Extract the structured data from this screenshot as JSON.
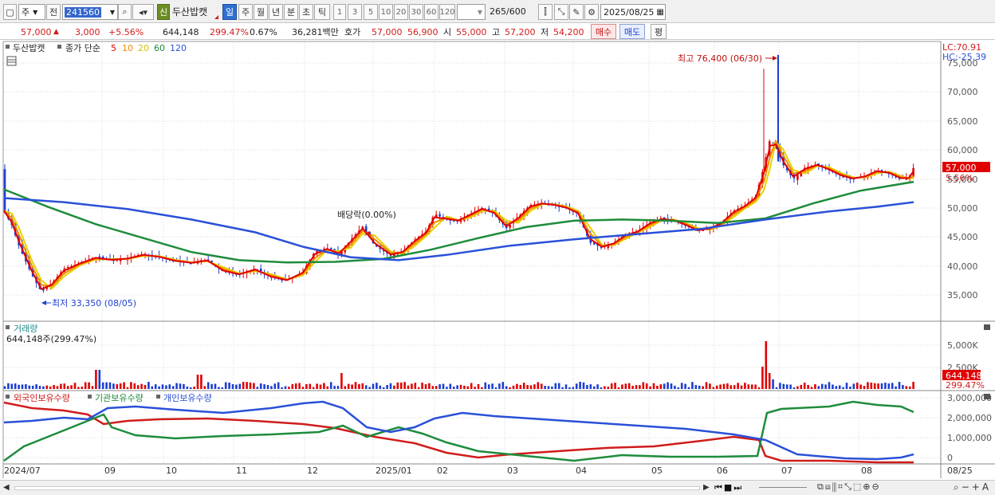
{
  "toolbar": {
    "market": "주",
    "prefix": "전",
    "code": "241560",
    "sin_badge": "신",
    "stock_name": "두산밥캣",
    "periods": [
      "일",
      "주",
      "월",
      "년",
      "분",
      "초",
      "틱"
    ],
    "selected_period": "일",
    "intervals": [
      "1",
      "3",
      "5",
      "10",
      "20",
      "30",
      "60",
      "120"
    ],
    "range_value": "265",
    "range_max": "/600",
    "date": "2025/08/25"
  },
  "quote": {
    "price": "57,000",
    "change": "3,000",
    "change_pct": "+5.56%",
    "volume": "644,148",
    "volume_ratio": "299.47%",
    "turnover_rate": "0.67%",
    "amount": "36,281백만",
    "bid_label": "호가",
    "ask": "57,000",
    "bid": "56,900",
    "open_label": "시",
    "open": "55,000",
    "high_label": "고",
    "high": "57,200",
    "low_label": "저",
    "low": "54,200",
    "buy_label": "매수",
    "sell_label": "매도",
    "avg_label": "평"
  },
  "price_panel": {
    "title": "두산밥캣",
    "legend_prefix": "종가 단순",
    "ma": [
      {
        "label": "5",
        "color": "#e00000"
      },
      {
        "label": "10",
        "color": "#f08c00"
      },
      {
        "label": "20",
        "color": "#e6d200"
      },
      {
        "label": "60",
        "color": "#1e8c3c"
      },
      {
        "label": "120",
        "color": "#2a50d8"
      }
    ],
    "lc": "LC:70.91",
    "hc": "HC:-25.39",
    "annot_high": "최고 76,400 (06/30)",
    "annot_low": "최저 33,350 (08/05)",
    "annot_dividend": "배당락(0.00%)",
    "price_tag": "57,000",
    "pct_tag": "5.56%",
    "ticks": [
      "75,000",
      "70,000",
      "65,000",
      "60,000",
      "55,000",
      "50,000",
      "45,000",
      "40,000",
      "35,000"
    ]
  },
  "volume_panel": {
    "title": "거래량",
    "value_label": "644,148주(299.47%)",
    "ticks": [
      "5,000K",
      "2,500K"
    ],
    "tag": "644,148",
    "tag_pct": "299.47%"
  },
  "holding_panel": {
    "legend": [
      {
        "label": "외국인보유수량",
        "color": "#d01c1c"
      },
      {
        "label": "기관보유수량",
        "color": "#1e8c3c"
      },
      {
        "label": "개인보유수량",
        "color": "#2a50d8"
      }
    ],
    "ticks": [
      "3,000,000",
      "2,000,000",
      "1,000,000",
      "0"
    ]
  },
  "x_axis": {
    "labels": [
      "2024/07",
      "09",
      "10",
      "11",
      "12",
      "2025/01",
      "02",
      "03",
      "04",
      "05",
      "06",
      "07",
      "08"
    ],
    "right_label": "08/25"
  },
  "colors": {
    "up": "#e00000",
    "down": "#1c3fd0",
    "grid": "#d9d9d9"
  }
}
